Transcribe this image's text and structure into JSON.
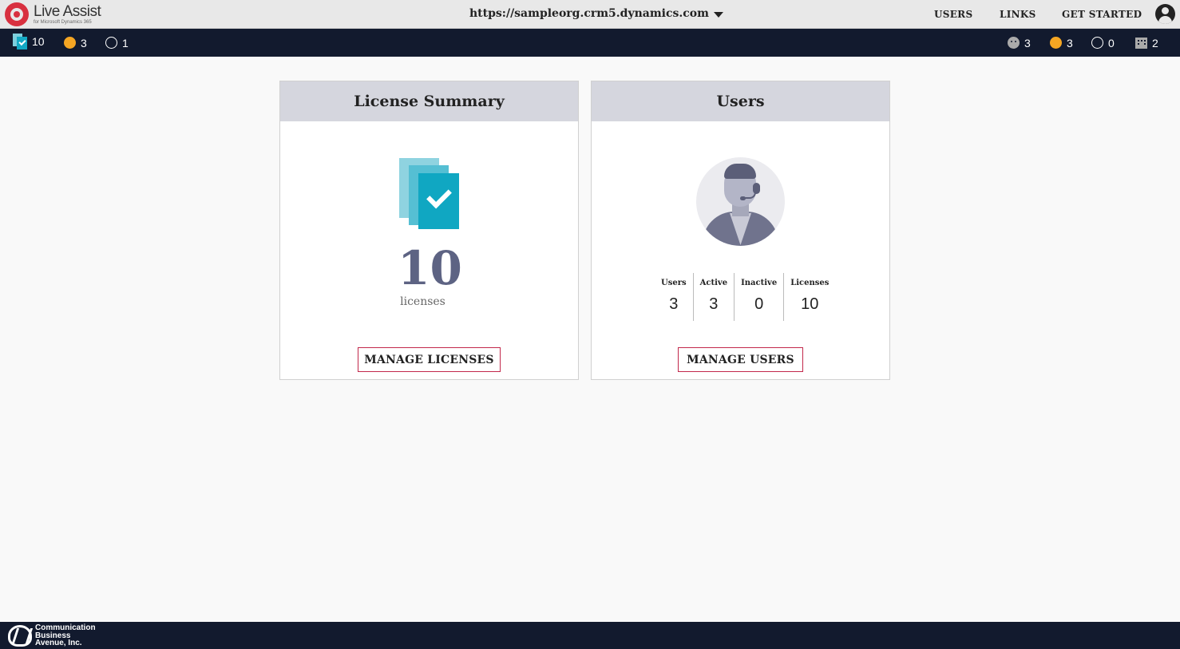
{
  "app": {
    "title": "Live Assist",
    "subtitle": "for Microsoft Dynamics 365",
    "url": "https://sampleorg.crm5.dynamics.com"
  },
  "nav": {
    "users": "USERS",
    "links": "LINKS",
    "get_started": "GET STARTED"
  },
  "statusbar": {
    "left": {
      "licenses": "10",
      "active": "3",
      "inactive": "1"
    },
    "right": {
      "agents": "3",
      "active": "3",
      "inactive": "0",
      "orgs": "2"
    },
    "colors": {
      "active": "#f5a623",
      "background": "#121a2e"
    }
  },
  "license_card": {
    "title": "License Summary",
    "count": "10",
    "count_label": "licenses",
    "button": "MANAGE LICENSES",
    "icon": "license-stack-check-icon"
  },
  "users_card": {
    "title": "Users",
    "icon": "support-agent-avatar-icon",
    "stats": [
      {
        "label": "Users",
        "value": "3"
      },
      {
        "label": "Active",
        "value": "3"
      },
      {
        "label": "Inactive",
        "value": "0"
      },
      {
        "label": "Licenses",
        "value": "10"
      }
    ],
    "button": "MANAGE USERS"
  },
  "footer": {
    "company_line1": "Communication",
    "company_line2": "Business",
    "company_line3": "Avenue, Inc."
  },
  "accent_color": "#c2284b"
}
